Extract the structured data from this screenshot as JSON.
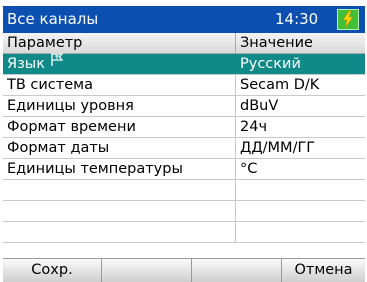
{
  "titlebar": {
    "title": "Все каналы",
    "time": "14:30",
    "battery_icon": "battery-charging-icon"
  },
  "table": {
    "headers": [
      "Параметр",
      "Значение"
    ],
    "rows": [
      {
        "param": "Язык",
        "value": "Русский",
        "selected": true
      },
      {
        "param": "ТВ система",
        "value": "Secam D/K"
      },
      {
        "param": "Единицы уровня",
        "value": "dBuV"
      },
      {
        "param": "Формат времени",
        "value": "24ч"
      },
      {
        "param": "Формат даты",
        "value": "ДД/ММ/ГГ"
      },
      {
        "param": "Единицы температуры",
        "value": "°C"
      },
      {
        "param": "",
        "value": ""
      },
      {
        "param": "",
        "value": ""
      },
      {
        "param": "",
        "value": ""
      }
    ]
  },
  "softkeys": [
    "Сохр.",
    "",
    "",
    "Отмена"
  ],
  "colors": {
    "titlebar": "#0b4fb0",
    "selection": "#0f8a89",
    "battery": "#3fbf3a"
  }
}
